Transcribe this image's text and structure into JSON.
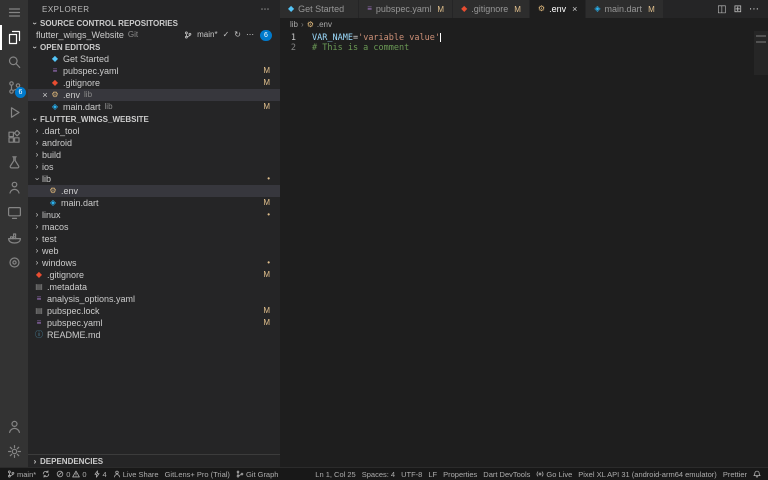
{
  "colors": {
    "accent": "#007acc",
    "modified_badge": "#e2c08d",
    "list_selection": "#37373d",
    "variable": "#9cdcfe",
    "string": "#ce9178",
    "comment": "#6a9955"
  },
  "glyphs": {
    "chevron": "›",
    "more": "⋯",
    "close": "×",
    "split_editor": "◫",
    "editor_layout": "⊞",
    "check": "✓",
    "refresh": "↻",
    "flutter": "◆",
    "dart": "◈",
    "git": "◆",
    "yaml": "≡",
    "gear": "⚙",
    "file": "▤",
    "info": "ⓘ"
  },
  "activity_bar": {
    "scm_badge": "6"
  },
  "sidebar": {
    "title": "EXPLORER",
    "repos": {
      "title": "SOURCE CONTROL REPOSITORIES",
      "name": "flutter_wings_Website",
      "type": "Git",
      "branch": "main*",
      "badge": "6"
    },
    "open_editors": {
      "title": "OPEN EDITORS",
      "items": [
        {
          "label": "Get Started",
          "badge": ""
        },
        {
          "label": "pubspec.yaml",
          "badge": "M"
        },
        {
          "label": ".gitignore",
          "badge": "M"
        },
        {
          "label": ".env",
          "detail": "lib",
          "badge": ""
        },
        {
          "label": "main.dart",
          "detail": "lib",
          "badge": "M"
        }
      ]
    },
    "workspace": {
      "title": "FLUTTER_WINGS_WEBSITE",
      "items": [
        {
          "label": ".dart_tool",
          "badge": ""
        },
        {
          "label": "android",
          "badge": ""
        },
        {
          "label": "build",
          "badge": ""
        },
        {
          "label": "ios",
          "badge": ""
        },
        {
          "label": "lib",
          "badge": "•"
        },
        {
          "label": ".env",
          "badge": ""
        },
        {
          "label": "main.dart",
          "badge": "M"
        },
        {
          "label": "linux",
          "badge": "•"
        },
        {
          "label": "macos",
          "badge": ""
        },
        {
          "label": "test",
          "badge": ""
        },
        {
          "label": "web",
          "badge": ""
        },
        {
          "label": "windows",
          "badge": "•"
        },
        {
          "label": ".gitignore",
          "badge": "M"
        },
        {
          "label": ".metadata",
          "badge": ""
        },
        {
          "label": "analysis_options.yaml",
          "badge": ""
        },
        {
          "label": "pubspec.lock",
          "badge": "M"
        },
        {
          "label": "pubspec.yaml",
          "badge": "M"
        },
        {
          "label": "README.md",
          "badge": ""
        }
      ]
    },
    "dependencies": {
      "title": "DEPENDENCIES"
    }
  },
  "tabs": {
    "items": [
      {
        "label": "Get Started",
        "badge": ""
      },
      {
        "label": "pubspec.yaml",
        "badge": "M"
      },
      {
        "label": ".gitignore",
        "badge": "M"
      },
      {
        "label": ".env",
        "badge": ""
      },
      {
        "label": "main.dart",
        "badge": "M"
      }
    ]
  },
  "breadcrumb": {
    "folder": "lib",
    "file": ".env"
  },
  "editor": {
    "line_numbers": [
      "1",
      "2"
    ],
    "line1": {
      "variable": "VAR_NAME",
      "operator": "=",
      "string": "'variable value'"
    },
    "line2": {
      "comment": "# This is a comment"
    }
  },
  "status_bar": {
    "branch": "main*",
    "errors": "0",
    "warnings": "0",
    "ports": "4",
    "live_share": "Live Share",
    "gitlens": "GitLens+ Pro (Trial)",
    "git_graph": "Git Graph",
    "cursor_position": "Ln 1, Col 25",
    "indentation": "Spaces: 4",
    "encoding": "UTF-8",
    "eol": "LF",
    "language_mode": "Properties",
    "dart_devtools": "Dart DevTools",
    "go_live": "Go Live",
    "device": "Pixel XL API 31 (android-arm64 emulator)",
    "formatter": "Prettier"
  }
}
